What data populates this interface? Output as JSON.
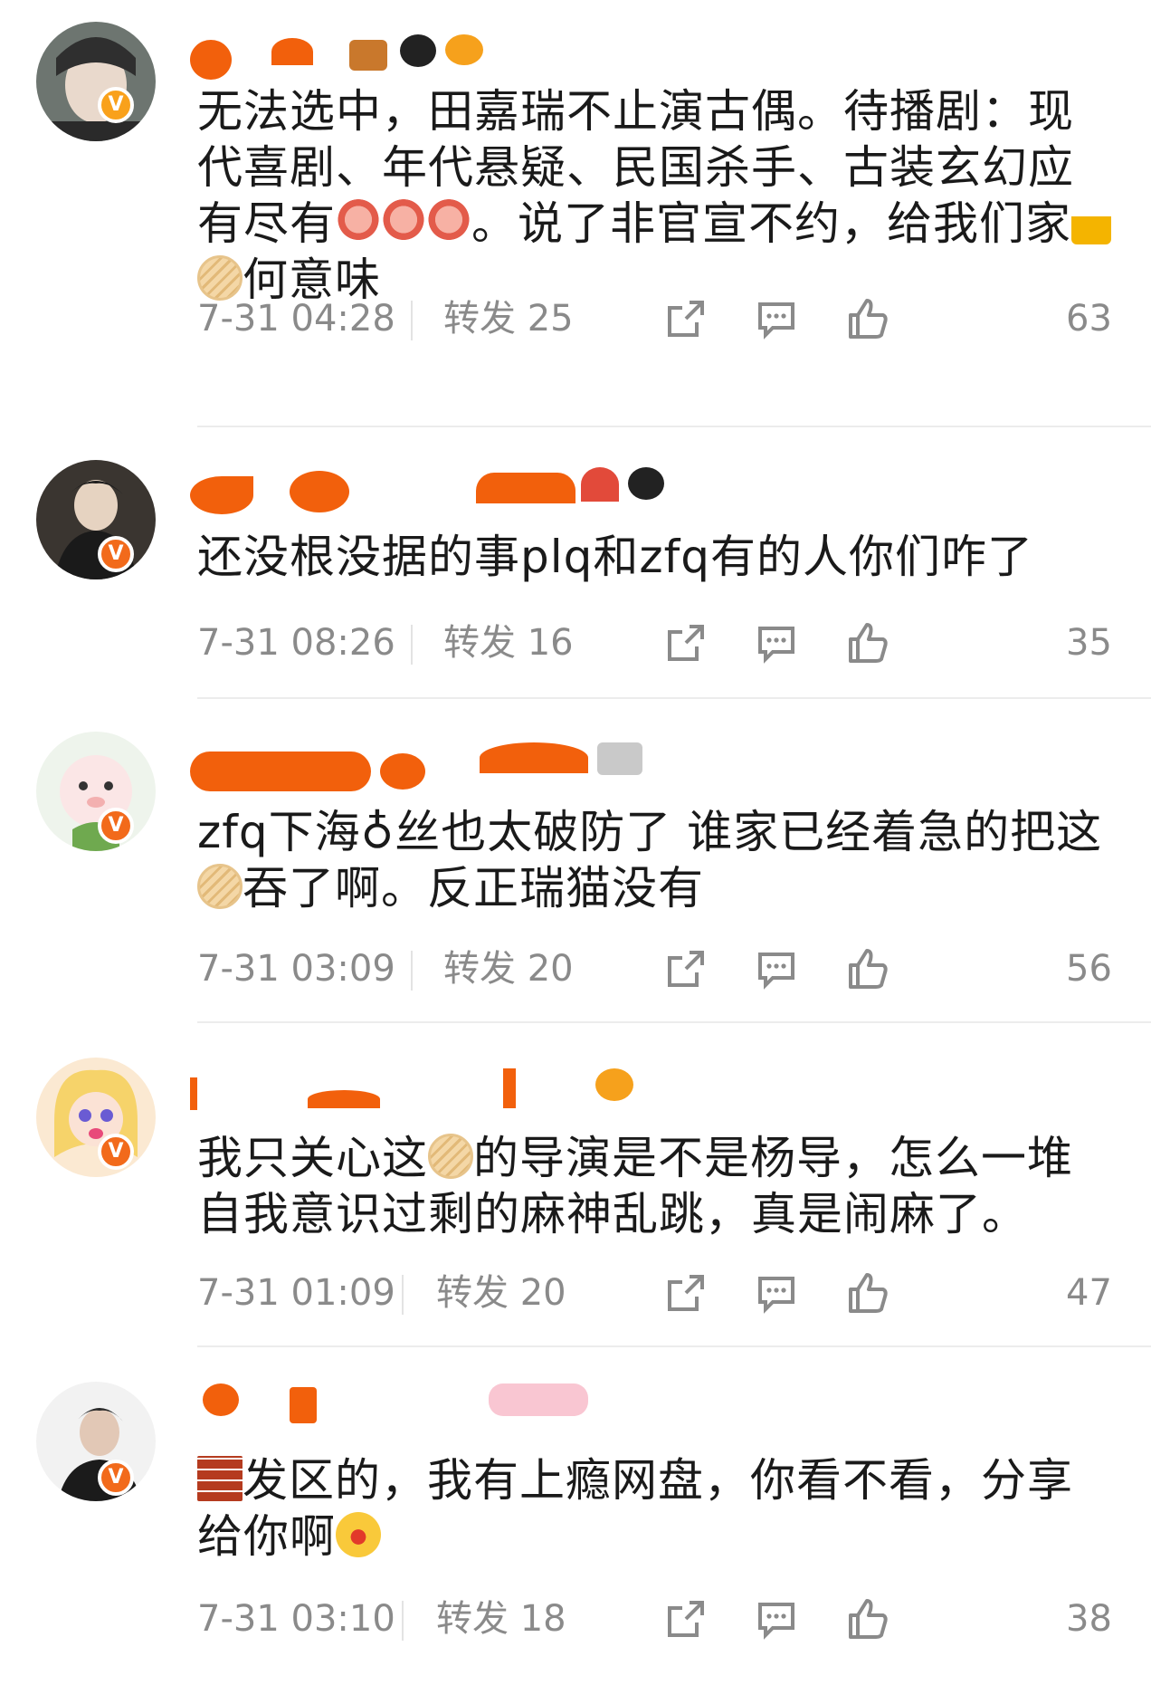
{
  "comments": [
    {
      "text_parts": [
        "无法选中，田嘉瑞不止演古偶。待播剧：现代喜剧、年代悬疑、民国杀手、古装玄幻应有尽有",
        "。说了非官宣不约，给我们家",
        "何意味"
      ],
      "time": "7-31 04:28",
      "repost": "转发 25",
      "likes": "63"
    },
    {
      "text_parts": [
        "还没根没据的事plq和zfq有的人你们咋了"
      ],
      "time": "7-31 08:26",
      "repost": "转发 16",
      "likes": "35"
    },
    {
      "text_parts": [
        "zfq下海♁丝也太破防了 谁家已经着急的把这",
        "吞了啊。反正瑞猫没有"
      ],
      "time": "7-31 03:09",
      "repost": "转发 20",
      "likes": "56"
    },
    {
      "text_parts": [
        "我只关心这",
        "的导演是不是杨导，怎么一堆自我意识过剩的麻神乱跳，真是闹麻了。"
      ],
      "time": "7-31 01:09",
      "repost": "转发 20",
      "likes": "47"
    },
    {
      "text_parts": [
        "发区的，我有上瘾网盘，你看不看，分享给你啊"
      ],
      "time": "7-31 03:10",
      "repost": "转发 18",
      "likes": "38"
    }
  ],
  "badges": {
    "verified": "V"
  },
  "icons": [
    "share-icon",
    "comment-icon",
    "like-icon",
    "shrimp-emoji",
    "melon-emoji",
    "lock-emoji",
    "brick-emoji",
    "drooling-face-emoji"
  ],
  "colors": {
    "text": "#1a1a1a",
    "meta": "#8a8a8a",
    "username": "#f2600c",
    "badge": "#f9a11b"
  }
}
